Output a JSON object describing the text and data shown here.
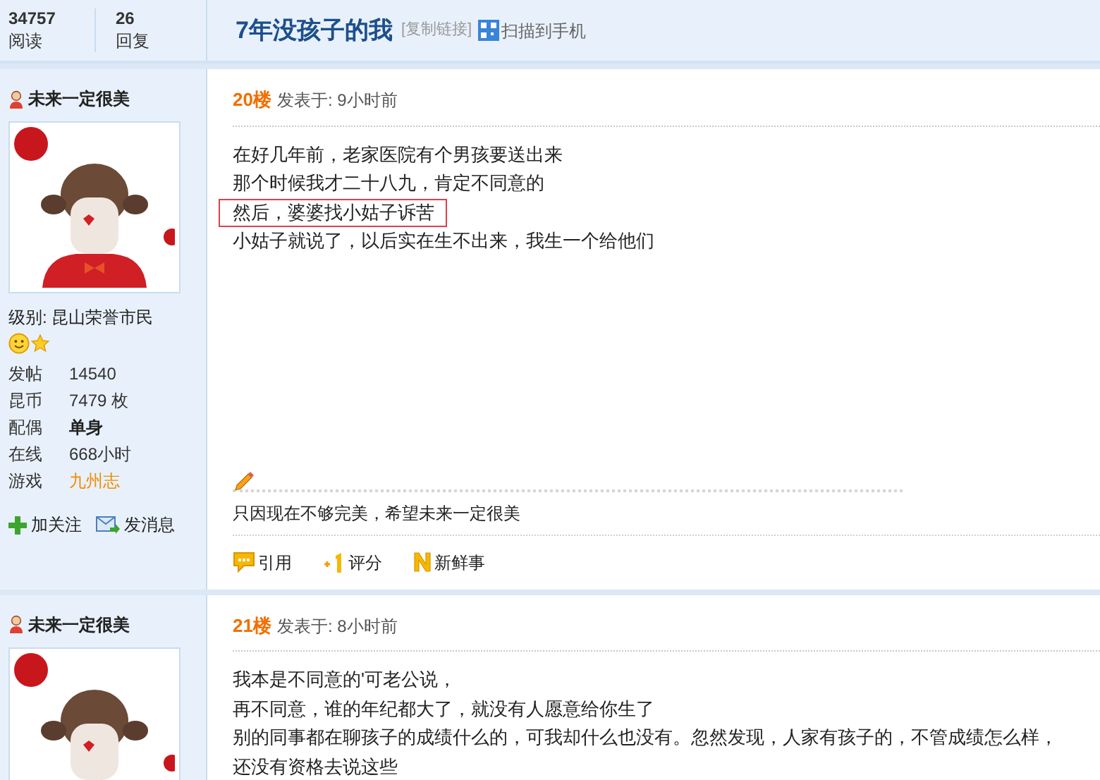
{
  "thread_stats": [
    {
      "value": "34757",
      "label": "阅读"
    },
    {
      "value": "26",
      "label": "回复"
    }
  ],
  "title": "7年没孩子的我",
  "copy_link": "[复制链接]",
  "scan": "扫描到手机",
  "posts": [
    {
      "floor": "20楼",
      "posted": "发表于: 9小时前",
      "author": {
        "name": "未来一定很美",
        "level_label": "级别:",
        "level": "昆山荣誉市民",
        "stats": [
          {
            "label": "发帖",
            "value": "14540",
            "kind": "plain"
          },
          {
            "label": "昆币",
            "value": "7479 枚",
            "kind": "plain"
          },
          {
            "label": "配偶",
            "value": "单身",
            "kind": "bold"
          },
          {
            "label": "在线",
            "value": "668小时",
            "kind": "plain"
          },
          {
            "label": "游戏",
            "value": "九州志",
            "kind": "link"
          }
        ],
        "actions": [
          {
            "kind": "follow",
            "label": "加关注"
          },
          {
            "kind": "message",
            "label": "发消息"
          }
        ]
      },
      "lines": [
        {
          "text": "在好几年前，老家医院有个男孩要送出来",
          "highlighted": false
        },
        {
          "text": "那个时候我才二十八九，肯定不同意的",
          "highlighted": false
        },
        {
          "text": "然后，婆婆找小姑子诉苦",
          "highlighted": true
        },
        {
          "text": "小姑子就说了，以后实在生不出来，我生一个给他们",
          "highlighted": false
        }
      ],
      "signature": "只因现在不够完美，希望未来一定很美",
      "actions": [
        {
          "kind": "quote",
          "label": "引用"
        },
        {
          "kind": "rate",
          "label": "评分"
        },
        {
          "kind": "news",
          "label": "新鲜事"
        }
      ]
    },
    {
      "floor": "21楼",
      "posted": "发表于: 8小时前",
      "author": {
        "name": "未来一定很美"
      },
      "lines": [
        {
          "text": "我本是不同意的'可老公说，",
          "highlighted": false
        },
        {
          "text": "再不同意，谁的年纪都大了，就没有人愿意给你生了",
          "highlighted": false
        },
        {
          "text": "别的同事都在聊孩子的成绩什么的，可我却什么也没有。忽然发现，人家有孩子的，不管成绩怎么样，",
          "highlighted": false
        },
        {
          "text": "还没有资格去说这些",
          "highlighted": false
        }
      ]
    }
  ]
}
